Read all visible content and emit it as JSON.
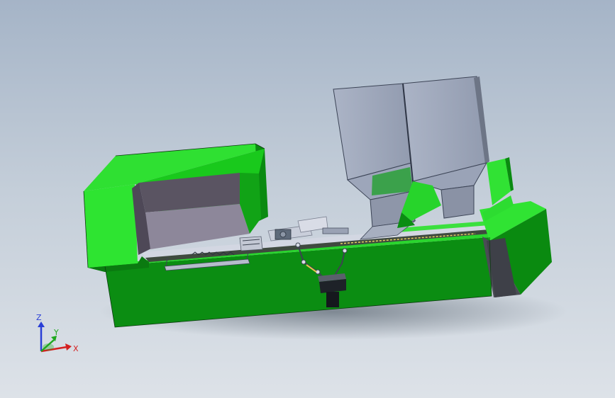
{
  "triad": {
    "x_label": "X",
    "z_label": "Z",
    "y_label": "Y",
    "x_color": "#d42020",
    "y_color": "#1fa81f",
    "z_color": "#2a3fd6"
  },
  "model": {
    "body_color": "#0a8a10",
    "body_light_color": "#27e32a",
    "body_dark_color": "#066a0a",
    "hopper_color": "#9aa3b8",
    "metal_color": "#c6cbd8"
  }
}
